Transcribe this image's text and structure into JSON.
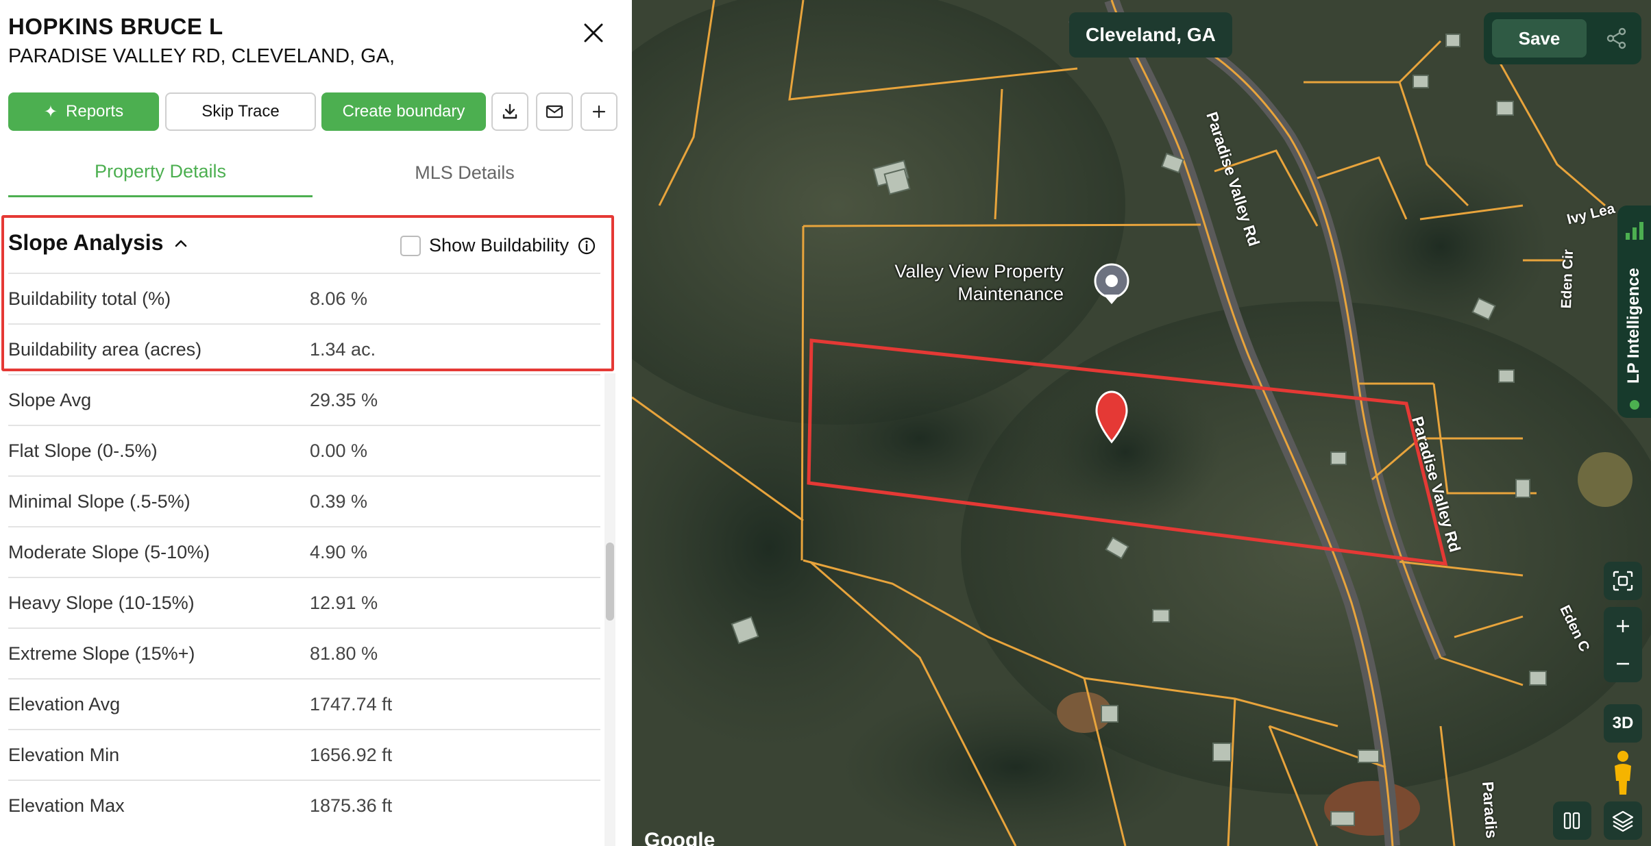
{
  "header": {
    "owner_name": "HOPKINS BRUCE L",
    "address": "PARADISE VALLEY RD, CLEVELAND, GA,"
  },
  "actions": {
    "reports_label": "Reports",
    "skip_trace_label": "Skip Trace",
    "create_boundary_label": "Create boundary",
    "icons": [
      "download-icon",
      "mail-icon",
      "plus-icon"
    ]
  },
  "tabs": [
    {
      "label": "Property Details",
      "active": true
    },
    {
      "label": "MLS Details",
      "active": false
    }
  ],
  "slope_analysis": {
    "title": "Slope Analysis",
    "show_buildability_label": "Show Buildability",
    "show_buildability_checked": false,
    "rows": [
      {
        "label": "Buildability total (%)",
        "value": "8.06 %"
      },
      {
        "label": "Buildability area (acres)",
        "value": "1.34 ac."
      },
      {
        "label": "Slope Avg",
        "value": "29.35 %"
      },
      {
        "label": "Flat Slope (0-.5%)",
        "value": "0.00 %"
      },
      {
        "label": "Minimal Slope (.5-5%)",
        "value": "0.39 %"
      },
      {
        "label": "Moderate Slope (5-10%)",
        "value": "4.90 %"
      },
      {
        "label": "Heavy Slope (10-15%)",
        "value": "12.91 %"
      },
      {
        "label": "Extreme Slope (15%+)",
        "value": "81.80 %"
      },
      {
        "label": "Elevation Avg",
        "value": "1747.74 ft"
      },
      {
        "label": "Elevation Min",
        "value": "1656.92 ft"
      },
      {
        "label": "Elevation Max",
        "value": "1875.36 ft"
      }
    ]
  },
  "map": {
    "city_label": "Cleveland, GA",
    "save_label": "Save",
    "poi_label": "Valley View Property Maintenance",
    "road_labels": [
      "Paradise Valley Rd",
      "Paradise Valley Rd",
      "Paradis",
      "Eden Cir",
      "Eden C",
      "Ivy Lea"
    ],
    "side_tab_label": "LP Intelligence",
    "three_d_label": "3D",
    "attribution": "Google"
  },
  "colors": {
    "accent_green": "#4caf50",
    "highlight_red": "#e53935",
    "parcel_line": "#e8a43c",
    "boundary_red": "#e53935",
    "map_chrome": "#1e3a2f"
  }
}
